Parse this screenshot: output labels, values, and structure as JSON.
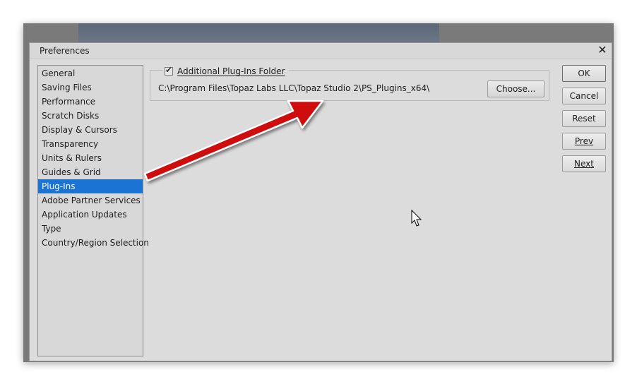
{
  "dialog": {
    "title": "Preferences",
    "close_glyph": "✕"
  },
  "categories": [
    {
      "label": "General",
      "selected": false
    },
    {
      "label": "Saving Files",
      "selected": false
    },
    {
      "label": "Performance",
      "selected": false
    },
    {
      "label": "Scratch Disks",
      "selected": false
    },
    {
      "label": "Display & Cursors",
      "selected": false
    },
    {
      "label": "Transparency",
      "selected": false
    },
    {
      "label": "Units & Rulers",
      "selected": false
    },
    {
      "label": "Guides & Grid",
      "selected": false
    },
    {
      "label": "Plug-Ins",
      "selected": true
    },
    {
      "label": "Adobe Partner Services",
      "selected": false
    },
    {
      "label": "Application Updates",
      "selected": false
    },
    {
      "label": "Type",
      "selected": false
    },
    {
      "label": "Country/Region Selection",
      "selected": false
    }
  ],
  "plugins": {
    "additional_folder_label": "Additional Plug-Ins Folder",
    "additional_folder_checked": true,
    "folder_path": "C:\\Program Files\\Topaz Labs LLC\\Topaz Studio 2\\PS_Plugins_x64\\",
    "choose_label": "Choose..."
  },
  "buttons": {
    "ok": "OK",
    "cancel": "Cancel",
    "reset": "Reset",
    "prev": "Prev",
    "next": "Next"
  },
  "colors": {
    "selection": "#1b73d4",
    "annotation_arrow": "#d01010"
  },
  "icons": {
    "close": "close-icon",
    "check": "check-icon",
    "cursor": "mouse-pointer-icon",
    "annotation": "red-arrow-annotation"
  }
}
